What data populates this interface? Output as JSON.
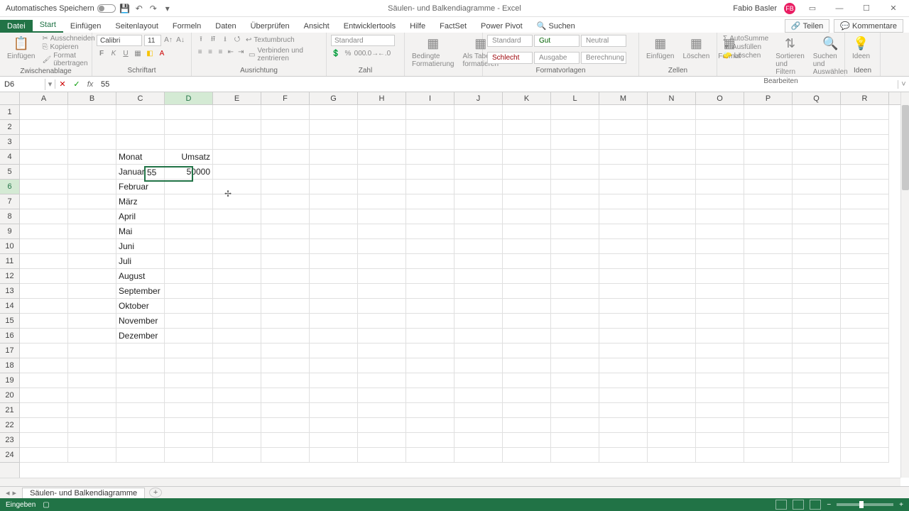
{
  "titlebar": {
    "autosave": "Automatisches Speichern",
    "doc_title": "Säulen- und Balkendiagramme - Excel",
    "user_name": "Fabio Basler",
    "user_initials": "FB"
  },
  "ribbon": {
    "tabs": [
      "Datei",
      "Start",
      "Einfügen",
      "Seitenlayout",
      "Formeln",
      "Daten",
      "Überprüfen",
      "Ansicht",
      "Entwicklertools",
      "Hilfe",
      "FactSet",
      "Power Pivot"
    ],
    "search_placeholder": "Suchen",
    "share": "Teilen",
    "comments": "Kommentare",
    "groups": {
      "clipboard": "Zwischenablage",
      "clipboard_paste": "Einfügen",
      "clipboard_cut": "Ausschneiden",
      "clipboard_copy": "Kopieren",
      "clipboard_format": "Format übertragen",
      "font": "Schriftart",
      "font_name": "Calibri",
      "font_size": "11",
      "alignment": "Ausrichtung",
      "wrap": "Textumbruch",
      "merge": "Verbinden und zentrieren",
      "number": "Zahl",
      "number_format": "Standard",
      "cond_fmt": "Bedingte Formatierung",
      "as_table": "Als Tabelle formatieren",
      "styles": "Formatvorlagen",
      "style_standard": "Standard",
      "style_bad": "Schlecht",
      "style_good": "Gut",
      "style_neutral": "Neutral",
      "style_output": "Ausgabe",
      "style_calc": "Berechnung",
      "cells": "Zellen",
      "cells_insert": "Einfügen",
      "cells_delete": "Löschen",
      "cells_format": "Format",
      "editing": "Bearbeiten",
      "autosum": "AutoSumme",
      "fill": "Ausfüllen",
      "clear": "Löschen",
      "sort": "Sortieren und Filtern",
      "find": "Suchen und Auswählen",
      "ideas": "Ideen"
    }
  },
  "formula_bar": {
    "cell_ref": "D6",
    "formula": "55"
  },
  "columns": [
    "A",
    "B",
    "C",
    "D",
    "E",
    "F",
    "G",
    "H",
    "I",
    "J",
    "K",
    "L",
    "M",
    "N",
    "O",
    "P",
    "Q",
    "R"
  ],
  "active_col_index": 3,
  "active_row_index": 5,
  "sheet_data": {
    "C4": "Monat",
    "D4": "Umsatz",
    "C5": "Januar",
    "D5": "50000",
    "C6": "Februar",
    "D6_edit": "55",
    "C7": "März",
    "C8": "April",
    "C9": "Mai",
    "C10": "Juni",
    "C11": "Juli",
    "C12": "August",
    "C13": "September",
    "C14": "Oktober",
    "C15": "November",
    "C16": "Dezember"
  },
  "sheet_tab": "Säulen- und Balkendiagramme",
  "statusbar": {
    "mode": "Eingeben"
  }
}
